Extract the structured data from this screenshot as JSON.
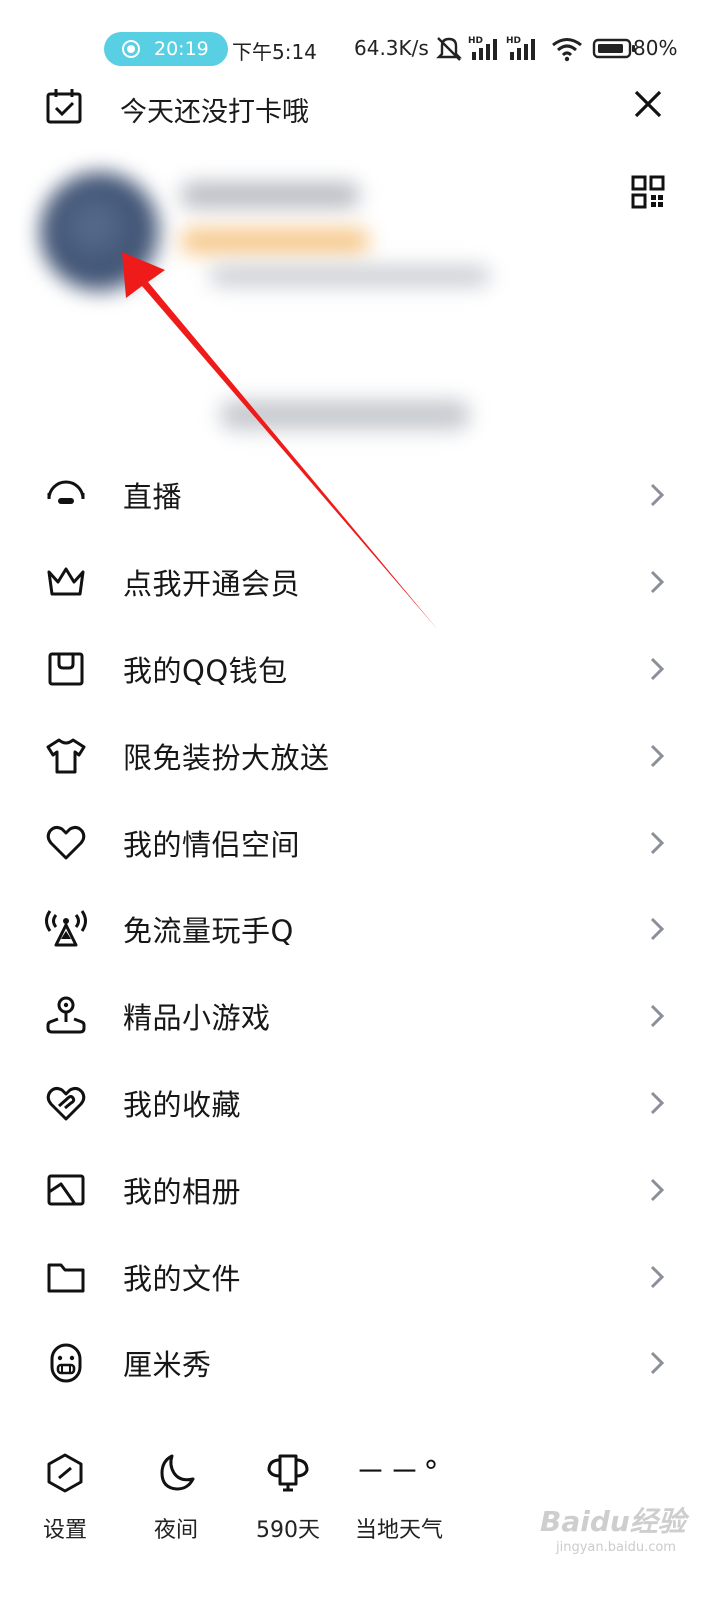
{
  "status_bar": {
    "recording_time": "20:19",
    "clock": "下午5:14",
    "net_speed": "64.3K/s",
    "battery_percent": "80%",
    "icons": [
      "mute-icon",
      "hd-signal-icon",
      "hd-signal-icon",
      "wifi-icon",
      "battery-icon"
    ]
  },
  "header": {
    "checkin_text": "今天还没打卡哦",
    "checkin_icon": "calendar-check-icon",
    "close_icon": "close-icon"
  },
  "profile": {
    "qr_icon": "qr-code-icon"
  },
  "menu": {
    "items": [
      {
        "label": "直播",
        "icon": "live-icon"
      },
      {
        "label": "点我开通会员",
        "icon": "crown-icon"
      },
      {
        "label": "我的QQ钱包",
        "icon": "wallet-icon"
      },
      {
        "label": "限免装扮大放送",
        "icon": "tshirt-icon"
      },
      {
        "label": "我的情侣空间",
        "icon": "heart-icon"
      },
      {
        "label": "免流量玩手Q",
        "icon": "signal-tower-icon"
      },
      {
        "label": "精品小游戏",
        "icon": "joystick-icon"
      },
      {
        "label": "我的收藏",
        "icon": "favorite-icon"
      },
      {
        "label": "我的相册",
        "icon": "album-icon"
      },
      {
        "label": "我的文件",
        "icon": "folder-icon"
      },
      {
        "label": "厘米秀",
        "icon": "cmshow-icon"
      }
    ]
  },
  "bottom_bar": {
    "settings": "设置",
    "night": "夜间",
    "days": "590天",
    "weather_temp": "－－°",
    "weather": "当地天气"
  },
  "watermark": {
    "brand": "Baidu经验",
    "url": "jingyan.baidu.com"
  },
  "colors": {
    "accent_pill": "#58cfe2",
    "annotation_arrow": "#ef1b1b",
    "text": "#171717"
  }
}
